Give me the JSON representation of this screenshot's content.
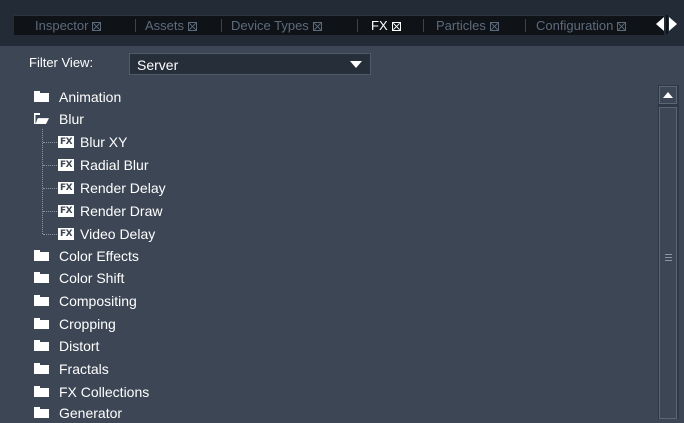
{
  "tabs": [
    {
      "label": "Inspector",
      "active": false
    },
    {
      "label": "Assets",
      "active": false
    },
    {
      "label": "Device Types",
      "active": false
    },
    {
      "label": "FX",
      "active": true
    },
    {
      "label": "Particles",
      "active": false
    },
    {
      "label": "Configuration",
      "active": false
    }
  ],
  "filter": {
    "label": "Filter View:",
    "value": "Server"
  },
  "tree": {
    "items": [
      {
        "label": "Animation",
        "type": "folder",
        "expanded": false
      },
      {
        "label": "Blur",
        "type": "folder",
        "expanded": true,
        "children": [
          {
            "label": "Blur XY",
            "icon_text": "FX"
          },
          {
            "label": "Radial Blur",
            "icon_text": "FX"
          },
          {
            "label": "Render Delay",
            "icon_text": "FX"
          },
          {
            "label": "Render Draw",
            "icon_text": "FX"
          },
          {
            "label": "Video Delay",
            "icon_text": "FX"
          }
        ]
      },
      {
        "label": "Color Effects",
        "type": "folder",
        "expanded": false
      },
      {
        "label": "Color Shift",
        "type": "folder",
        "expanded": false
      },
      {
        "label": "Compositing",
        "type": "folder",
        "expanded": false
      },
      {
        "label": "Cropping",
        "type": "folder",
        "expanded": false
      },
      {
        "label": "Distort",
        "type": "folder",
        "expanded": false
      },
      {
        "label": "Fractals",
        "type": "folder",
        "expanded": false
      },
      {
        "label": "FX Collections",
        "type": "folder",
        "expanded": false
      },
      {
        "label": "Generator",
        "type": "folder",
        "expanded": false
      }
    ]
  },
  "colors": {
    "background": "#3c4654",
    "tab_strip": "#0f1318",
    "inactive_tab_text": "#5d6a7b",
    "text": "#ffffff"
  }
}
